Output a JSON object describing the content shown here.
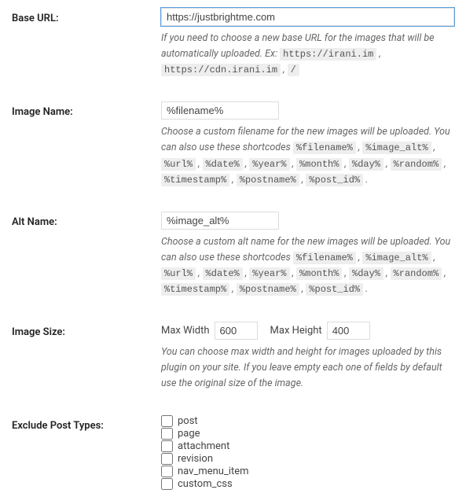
{
  "base_url": {
    "label": "Base URL:",
    "value": "https://justbrightme.com",
    "desc_prefix": "If you need to choose a new base URL for the images that will be automatically uploaded. Ex: ",
    "examples": [
      "https://irani.im",
      "https://cdn.irani.im",
      "/"
    ]
  },
  "image_name": {
    "label": "Image Name:",
    "value": "%filename%",
    "desc_prefix": "Choose a custom filename for the new images will be uploaded. You can also use these shortcodes ",
    "codes": [
      "%filename%",
      "%image_alt%",
      "%url%",
      "%date%",
      "%year%",
      "%month%",
      "%day%",
      "%random%",
      "%timestamp%",
      "%postname%",
      "%post_id%"
    ]
  },
  "alt_name": {
    "label": "Alt Name:",
    "value": "%image_alt%",
    "desc_prefix": "Choose a custom alt name for the new images will be uploaded. You can also use these shortcodes ",
    "codes": [
      "%filename%",
      "%image_alt%",
      "%url%",
      "%date%",
      "%year%",
      "%month%",
      "%day%",
      "%random%",
      "%timestamp%",
      "%postname%",
      "%post_id%"
    ]
  },
  "image_size": {
    "label": "Image Size:",
    "max_width_label": "Max Width",
    "max_width_value": "600",
    "max_height_label": "Max Height",
    "max_height_value": "400",
    "desc": "You can choose max width and height for images uploaded by this plugin on your site. If you leave empty each one of fields by default use the original size of the image."
  },
  "exclude": {
    "label": "Exclude Post Types:",
    "items": [
      "post",
      "page",
      "attachment",
      "revision",
      "nav_menu_item",
      "custom_css"
    ]
  }
}
